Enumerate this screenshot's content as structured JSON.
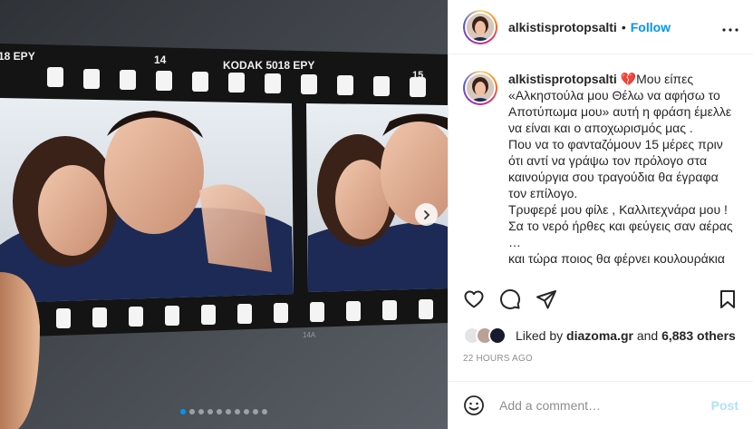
{
  "media": {
    "film_edge_left": "18 EPY",
    "film_frame_number": "14",
    "film_brand": "KODAK 5018 EPY",
    "film_frame_number_next": "15",
    "film_bottom_mark": "14A",
    "carousel_count": 10,
    "carousel_active_index": 0
  },
  "post": {
    "username": "alkistisprotopsalti",
    "separator": "•",
    "follow_label": "Follow",
    "more_glyph": "•••"
  },
  "caption": {
    "username": "alkistisprotopsalti",
    "emoji": "💔",
    "lines": [
      "Μου είπες",
      "«Αλκηστούλα μου Θέλω να αφήσω το Αποτύπωμα μου» αυτή η φράση έμελλε να είναι και ο αποχωρισμός μας .",
      "Που να το φανταζόμουν 15 μέρες πριν ότι αντί να γράψω τον πρόλογο στα καινούργια σου τραγούδια θα έγραφα τον επίλογο.",
      "Τρυφερέ μου φίλε , Καλλιτεχνάρα μου !",
      "Σα το νερό ήρθες και φεύγεις σαν αέρας …",
      "και τώρα ποιος θα φέρνει κουλουράκια"
    ]
  },
  "likes": {
    "prefix": "Liked by",
    "user": "diazoma.gr",
    "and": "and",
    "others": "6,883 others"
  },
  "timestamp": "22 HOURS AGO",
  "comment": {
    "placeholder": "Add a comment…",
    "post_label": "Post"
  },
  "colors": {
    "accent": "#0095f6",
    "post_disabled": "#b2dffc",
    "heart_broken": "#e0245e"
  }
}
